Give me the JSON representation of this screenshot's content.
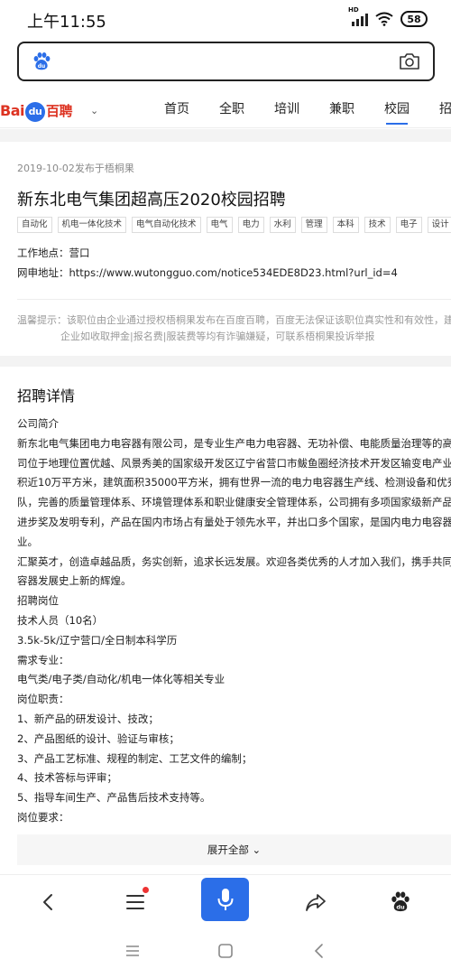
{
  "status_bar": {
    "time": "上午11:55",
    "signal_label": "HD",
    "battery": "58"
  },
  "search": {
    "logo_icon": "baidu-paw-icon",
    "camera_icon": "camera-icon",
    "value": ""
  },
  "nav": {
    "brand": {
      "bai": "Bai",
      "du": "du",
      "pin": "百聘"
    },
    "tabs": [
      "首页",
      "全职",
      "培训",
      "兼职",
      "校园",
      "招"
    ],
    "active_tab": "校园"
  },
  "job": {
    "publish_info": "2019-10-02发布于梧桐果",
    "title": "新东北电气集团超高压2020校园招聘",
    "tags": [
      "自动化",
      "机电一体化技术",
      "电气自动化技术",
      "电气",
      "电力",
      "水利",
      "管理",
      "本科",
      "技术",
      "电子",
      "设计"
    ],
    "location_label": "工作地点：营口",
    "url_label": "网申地址：https://www.wutongguo.com/notice534EDE8D23.html?url_id=4",
    "warning_line1": "温馨提示：该职位由企业通过授权梧桐果发布在百度百聘，百度无法保证该职位真实性和有效性，建议",
    "warning_line2": "企业如收取押金|报名费|服装费等均有诈骗嫌疑，可联系梧桐果投诉举报"
  },
  "details": {
    "title": "招聘详情",
    "lines": [
      "公司简介",
      "新东北电气集团电力电容器有限公司，是专业生产电力电容器、无功补偿、电能质量治理等的高新技术",
      "司位于地理位置优越、风景秀美的国家级开发区辽宁省营口市鲅鱼圈经济技术开发区输变电产业园。公",
      "积近10万平方米，建筑面积35000平方米，拥有世界一流的电力电容器生产线、检测设备和优秀的技术",
      "队，完善的质量管理体系、环境管理体系和职业健康安全管理体系，公司拥有多项国家级新产品奖、省",
      "进步奖及发明专利，产品在国内市场占有量处于领先水平，并出口多个国家，是国内电力电容器行业的",
      "业。",
      "汇聚英才，创造卓越品质，务实创新，追求长远发展。欢迎各类优秀的人才加入我们，携手共同书写中",
      "容器发展史上新的辉煌。",
      "招聘岗位",
      "技术人员（10名）",
      "3.5k-5k/辽宁营口/全日制本科学历",
      "需求专业：",
      "电气类/电子类/自动化/机电一体化等相关专业",
      "岗位职责：",
      "1、新产品的研发设计、技改；",
      "2、产品图纸的设计、验证与审核；",
      "3、产品工艺标准、规程的制定、工艺文件的编制；",
      "4、技术答标与评审；",
      "5、指导车间生产、产品售后技术支持等。",
      "岗位要求："
    ],
    "expand_label": "展开全部 ⌄"
  },
  "toolbar": {
    "icons": [
      "back-icon",
      "menu-icon",
      "microphone-icon",
      "share-icon",
      "baidu-paw-icon"
    ],
    "accent": "#2b6ee8",
    "badge_color": "#e33333"
  },
  "system_nav": {
    "icons": [
      "recent-apps-icon",
      "home-icon",
      "system-back-icon"
    ]
  }
}
